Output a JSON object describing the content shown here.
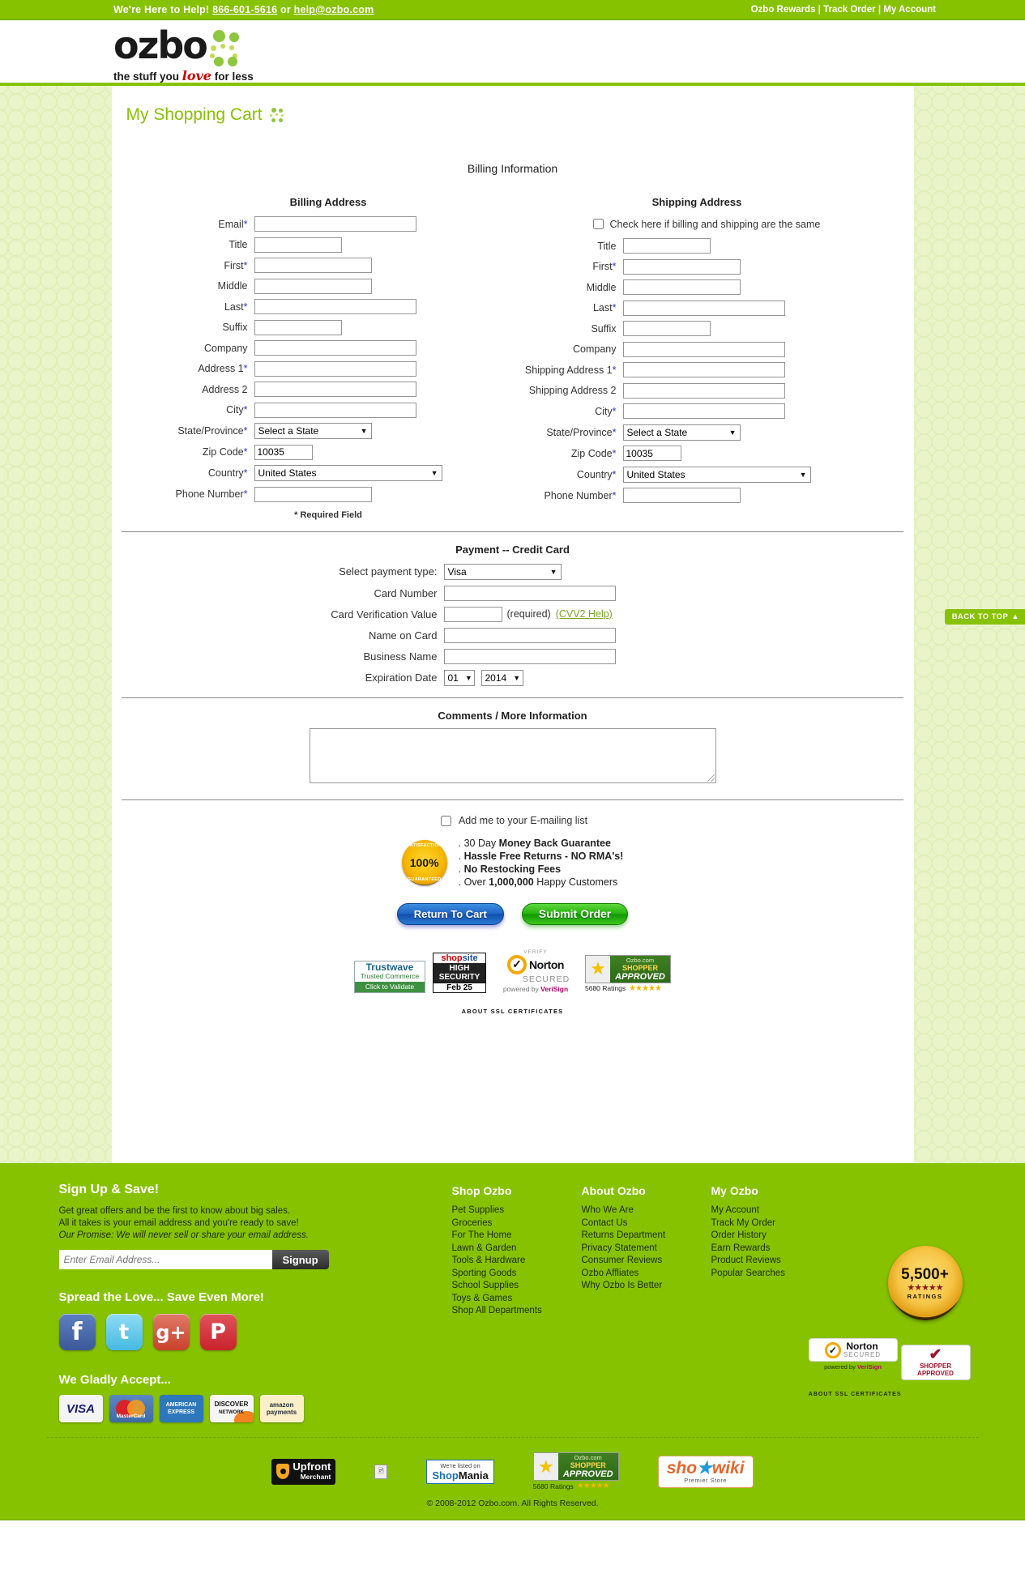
{
  "topbar": {
    "help_text": "We're Here to Help!",
    "phone": "866-601-5616",
    "or": "or",
    "email": "help@ozbo.com",
    "links": "Ozbo Rewards | Track Order | My Account"
  },
  "brand": {
    "name": "ozbo",
    "tagline_pre": "the stuff you ",
    "tagline_love": "love",
    "tagline_post": " for less"
  },
  "page": {
    "cart_title": "My Shopping Cart",
    "billing_info_heading": "Billing Information",
    "required_note": "* Required Field",
    "back_to_top": "BACK TO TOP"
  },
  "billing": {
    "heading": "Billing Address",
    "fields": [
      {
        "label": "Email",
        "required": true,
        "type": "text",
        "width": "w-xl",
        "value": ""
      },
      {
        "label": "Title",
        "required": false,
        "type": "text",
        "width": "w-sm",
        "value": ""
      },
      {
        "label": "First",
        "required": true,
        "type": "text",
        "width": "w-md",
        "value": ""
      },
      {
        "label": "Middle",
        "required": false,
        "type": "text",
        "width": "w-md",
        "value": ""
      },
      {
        "label": "Last",
        "required": true,
        "type": "text",
        "width": "w-xl",
        "value": ""
      },
      {
        "label": "Suffix",
        "required": false,
        "type": "text",
        "width": "w-sm",
        "value": ""
      },
      {
        "label": "Company",
        "required": false,
        "type": "text",
        "width": "w-xl",
        "value": ""
      },
      {
        "label": "Address 1",
        "required": true,
        "type": "text",
        "width": "w-xl",
        "value": ""
      },
      {
        "label": "Address 2",
        "required": false,
        "type": "text",
        "width": "w-xl",
        "value": ""
      },
      {
        "label": "City",
        "required": true,
        "type": "text",
        "width": "w-xl",
        "value": ""
      },
      {
        "label": "State/Province",
        "required": true,
        "type": "select",
        "width": "w-md",
        "value": "Select a State"
      },
      {
        "label": "Zip Code",
        "required": true,
        "type": "text",
        "width": "w-xs",
        "value": "10035"
      },
      {
        "label": "Country",
        "required": true,
        "type": "select",
        "width": "w-xxl",
        "value": "United States"
      },
      {
        "label": "Phone Number",
        "required": true,
        "type": "text",
        "width": "w-md",
        "value": ""
      }
    ]
  },
  "shipping": {
    "heading": "Shipping Address",
    "same_as_billing_label": "Check here if billing and shipping are the same",
    "same_as_billing_checked": false,
    "fields": [
      {
        "label": "Title",
        "required": false,
        "type": "text",
        "width": "w-sm",
        "value": ""
      },
      {
        "label": "First",
        "required": true,
        "type": "text",
        "width": "w-md",
        "value": ""
      },
      {
        "label": "Middle",
        "required": false,
        "type": "text",
        "width": "w-md",
        "value": ""
      },
      {
        "label": "Last",
        "required": true,
        "type": "text",
        "width": "w-xl",
        "value": ""
      },
      {
        "label": "Suffix",
        "required": false,
        "type": "text",
        "width": "w-sm",
        "value": ""
      },
      {
        "label": "Company",
        "required": false,
        "type": "text",
        "width": "w-xl",
        "value": ""
      },
      {
        "label": "Shipping Address 1",
        "required": true,
        "type": "text",
        "width": "w-xl",
        "value": ""
      },
      {
        "label": "Shipping Address 2",
        "required": false,
        "type": "text",
        "width": "w-xl",
        "value": ""
      },
      {
        "label": "City",
        "required": true,
        "type": "text",
        "width": "w-xl",
        "value": ""
      },
      {
        "label": "State/Province",
        "required": true,
        "type": "select",
        "width": "w-md",
        "value": "Select a State"
      },
      {
        "label": "Zip Code",
        "required": true,
        "type": "text",
        "width": "w-xs",
        "value": "10035"
      },
      {
        "label": "Country",
        "required": true,
        "type": "select",
        "width": "w-xxl",
        "value": "United States"
      },
      {
        "label": "Phone Number",
        "required": true,
        "type": "text",
        "width": "w-md",
        "value": ""
      }
    ]
  },
  "payment": {
    "heading": "Payment -- Credit Card",
    "payment_type_label": "Select payment type:",
    "payment_type_value": "Visa",
    "card_number_label": "Card Number",
    "card_number_value": "",
    "cvv_label": "Card Verification Value",
    "cvv_value": "",
    "cvv_required_text": "(required)",
    "cvv_help_link": "(CVV2 Help)",
    "name_on_card_label": "Name on Card",
    "name_on_card_value": "",
    "business_name_label": "Business Name",
    "business_name_value": "",
    "expiration_label": "Expiration Date",
    "expiration_month": "01",
    "expiration_year": "2014"
  },
  "comments": {
    "heading": "Comments / More Information",
    "value": ""
  },
  "emaillist": {
    "label": "Add me to your E-mailing list",
    "checked": false
  },
  "guarantee": {
    "seal_percent": "100%",
    "seal_top": "SATISFACTION",
    "seal_bottom": "GUARANTEED",
    "items": [
      {
        "pre": ". 30 Day ",
        "bold": "Money Back Guarantee",
        "post": ""
      },
      {
        "pre": ". ",
        "bold": "Hassle Free Returns - NO RMA's!",
        "post": ""
      },
      {
        "pre": ". ",
        "bold": "No Restocking Fees",
        "post": ""
      },
      {
        "pre": ". Over ",
        "bold": "1,000,000",
        "post": " Happy Customers"
      }
    ]
  },
  "actions": {
    "return_to_cart": "Return To Cart",
    "submit_order": "Submit Order"
  },
  "trust": {
    "trustwave_1": "Trustwave",
    "trustwave_2": "Trusted Commerce",
    "trustwave_3": "Click to Validate",
    "shopsite_a": "shop",
    "shopsite_b": "site",
    "shopsite_2": "HIGH SECURITY",
    "shopsite_3": "Feb  25",
    "norton_verify": "VERIFY",
    "norton_name": "Norton",
    "norton_secured": "SECURED",
    "norton_powered": "powered by ",
    "norton_verisign": "VeriSign",
    "shopper_site": "Ozbo.com",
    "shopper_word": "SHOPPER",
    "shopper_approved": "APPROVED",
    "shopper_ratings": "5680 Ratings",
    "shopper_stars": "★★★★★",
    "ssl_note": "ABOUT SSL CERTIFICATES"
  },
  "footer": {
    "signup_head": "Sign Up & Save!",
    "signup_line1": "Get great offers and be the first to know about big sales.",
    "signup_line2": "All it takes is your email address and you're ready to save!",
    "signup_line3": "Our Promise: We will never sell or share your email address.",
    "email_placeholder": "Enter Email Address...",
    "email_value": "",
    "signup_button": "Signup",
    "spread_head": "Spread the Love... Save Even More!",
    "social": [
      {
        "name": "facebook",
        "glyph": "f"
      },
      {
        "name": "twitter",
        "glyph": "t"
      },
      {
        "name": "googleplus",
        "glyph": "g+"
      },
      {
        "name": "pinterest",
        "glyph": "P"
      }
    ],
    "accept_head": "We Gladly Accept...",
    "cards": [
      "VISA",
      "MasterCard",
      "AMERICAN EXPRESS",
      "DISCOVER NETWORK",
      "amazon payments"
    ],
    "columns": [
      {
        "head": "Shop Ozbo",
        "links": [
          "Pet Supplies",
          "Groceries",
          "For The Home",
          "Lawn & Garden",
          "Tools & Hardware",
          "Sporting Goods",
          "School Supplies",
          "Toys & Games",
          "Shop All Departments"
        ]
      },
      {
        "head": "About Ozbo",
        "links": [
          "Who We Are",
          "Contact Us",
          "Returns Department",
          "Privacy Statement",
          "Consumer Reviews",
          "Ozbo Affliates",
          "Why Ozbo Is Better"
        ]
      },
      {
        "head": "My Ozbo",
        "links": [
          "My Account",
          "Track My Order",
          "Order History",
          "Earn Rewards",
          "Product Reviews",
          "Popular Searches"
        ]
      }
    ],
    "rating_seal_number": "5,500+",
    "rating_seal_stars": "★★★★★",
    "rating_seal_label": "RATINGS",
    "norton_name": "Norton",
    "norton_secured": "SECURED",
    "norton_powered": "powered by ",
    "norton_verisign": "VeriSign",
    "shopper_approved_top": "SHOPPER",
    "shopper_approved_bottom": "APPROVED",
    "ssl_note": "ABOUT SSL CERTIFICATES",
    "bottom_badges": {
      "upfront_1": "Upfront",
      "upfront_2": "Merchant",
      "shopmania_1": "We're listed on",
      "shopmania_a": "Shop",
      "shopmania_b": "Mania",
      "shopper_site": "Ozbo.com",
      "shopper_word": "SHOPPER",
      "shopper_approved": "APPROVED",
      "shopper_ratings": "5680 Ratings",
      "shopper_stars": "★★★★★",
      "shopwiki_a": "sho",
      "shopwiki_b": "wiki",
      "shopwiki_sub": "Premier Store"
    },
    "copyright": "© 2008-2012 Ozbo.com. All Rights Reserved."
  }
}
